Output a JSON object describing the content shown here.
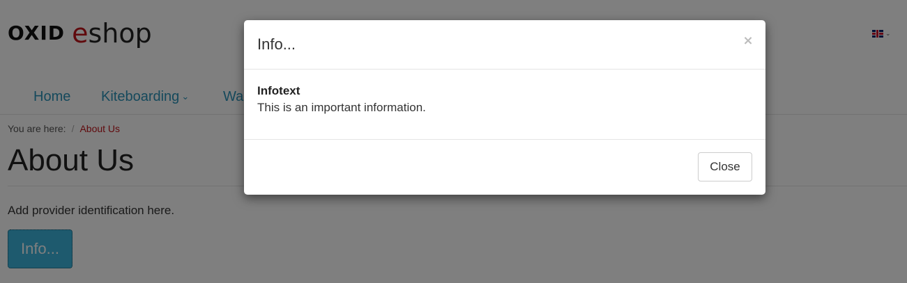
{
  "header": {
    "logo_oxid": "OXID",
    "logo_e": "e",
    "logo_shop": "shop",
    "language_icon": "uk-flag-icon",
    "language_caret_icon": "chevron-down-icon"
  },
  "nav": {
    "items": [
      {
        "label": "Home"
      },
      {
        "label": "Kiteboarding",
        "chevron": "⌄"
      },
      {
        "label": "Wa"
      }
    ]
  },
  "breadcrumb": {
    "prefix": "You are here:",
    "separator": "/",
    "current": "About Us"
  },
  "main": {
    "title": "About Us",
    "text": "Add provider identification here.",
    "info_button_label": "Info..."
  },
  "modal": {
    "title": "Info...",
    "close_symbol": "×",
    "body_heading": "Infotext",
    "body_text": "This is an important information.",
    "close_button_label": "Close"
  },
  "colors": {
    "nav_link": "#2a93b8",
    "breadcrumb_current": "#c0141b",
    "info_button": "#3db5dc",
    "logo_accent": "#c0141b"
  }
}
